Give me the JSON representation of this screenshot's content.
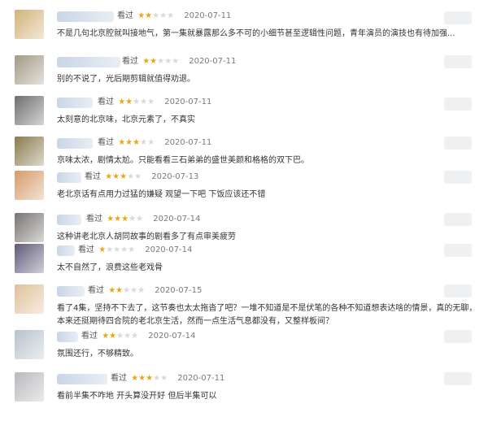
{
  "reviews": [
    {
      "watched": "看过",
      "stars": 2,
      "date": "2020-07-11",
      "comment": "不是几句北京腔就叫接地气，第一集就暴露那么多不可的小细节甚至逻辑性问题，青年演员的演技也有待加强...",
      "avatar": "#d2b27a"
    },
    {
      "watched": "看过",
      "stars": 2,
      "date": "2020-07-11",
      "comment": "别的不说了，光后期剪辑就值得劝退。",
      "avatar": "#a39a86"
    },
    {
      "watched": "看过",
      "stars": 2,
      "date": "2020-07-11",
      "comment": "太刻意的北京味，北京元素了，不真实",
      "avatar": "#6e6e6e"
    },
    {
      "watched": "看过",
      "stars": 3,
      "date": "2020-07-11",
      "comment": "京味太浓，剧情太尬。只能看看三石弟弟的盛世美颜和格格的双下巴。",
      "avatar": "#8a7a4e"
    },
    {
      "watched": "看过",
      "stars": 3,
      "date": "2020-07-13",
      "comment": "老北京话有点用力过猛的嫌疑 观望一下吧 下饭应该还不错",
      "avatar": "#d59b6b"
    },
    {
      "watched": "看过",
      "stars": 3,
      "date": "2020-07-14",
      "comment": "这种讲老北京人胡同故事的剧看多了有点审美疲劳",
      "avatar": "#7a7474"
    },
    {
      "watched": "看过",
      "stars": 1,
      "date": "2020-07-14",
      "comment": "太不自然了，浪费这些老戏骨",
      "avatar": "#5f5a78"
    },
    {
      "watched": "看过",
      "stars": 2,
      "date": "2020-07-15",
      "comment": "看了4集，坚持不下去了，这节奏也太太拖沓了吧？一堆不知道是不是伏笔的各种不知道想表达啥的情景，真的无聊，本来还挺期待四合院的老北京生活，然而一点生活气息都没有，又整样板间？",
      "avatar": "#e0c19a"
    },
    {
      "watched": "看过",
      "stars": 2,
      "date": "2020-07-14",
      "comment": "氛围还行，不够精致。",
      "avatar": "#b7c2cc"
    },
    {
      "watched": "看过",
      "stars": 3,
      "date": "2020-07-11",
      "comment": "看前半集不咋地 开头算没开好 但后半集可以",
      "avatar": "#b9b9bd"
    }
  ]
}
